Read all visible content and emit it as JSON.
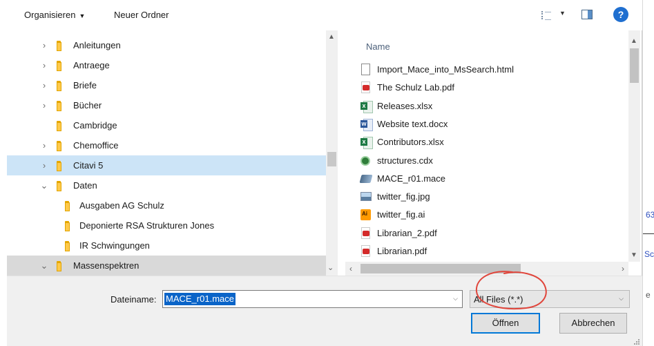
{
  "toolbar": {
    "organize_label": "Organisieren",
    "new_folder_label": "Neuer Ordner",
    "help_label": "?"
  },
  "nav": {
    "items": [
      {
        "label": "Anleitungen",
        "expander": "›"
      },
      {
        "label": "Antraege",
        "expander": "›"
      },
      {
        "label": "Briefe",
        "expander": "›"
      },
      {
        "label": "Bücher",
        "expander": "›"
      },
      {
        "label": "Cambridge",
        "expander": ""
      },
      {
        "label": "Chemoffice",
        "expander": "›"
      },
      {
        "label": "Citavi 5",
        "expander": "›"
      },
      {
        "label": "Daten",
        "expander": "⌄"
      },
      {
        "label": "Ausgaben AG Schulz",
        "expander": ""
      },
      {
        "label": "Deponierte RSA Strukturen Jones",
        "expander": ""
      },
      {
        "label": "IR Schwingungen",
        "expander": ""
      },
      {
        "label": "Massenspektren",
        "expander": "⌄"
      }
    ]
  },
  "files": {
    "column_name": "Name",
    "items": [
      {
        "name": "Import_Mace_into_MsSearch.html",
        "icon": "html-file-icon"
      },
      {
        "name": "The Schulz Lab.pdf",
        "icon": "pdf-file-icon"
      },
      {
        "name": "Releases.xlsx",
        "icon": "excel-file-icon"
      },
      {
        "name": "Website text.docx",
        "icon": "word-file-icon"
      },
      {
        "name": "Contributors.xlsx",
        "icon": "excel-file-icon"
      },
      {
        "name": "structures.cdx",
        "icon": "cdx-file-icon"
      },
      {
        "name": "MACE_r01.mace",
        "icon": "mace-file-icon"
      },
      {
        "name": "twitter_fig.jpg",
        "icon": "image-file-icon"
      },
      {
        "name": "twitter_fig.ai",
        "icon": "illustrator-file-icon"
      },
      {
        "name": "Librarian_2.pdf",
        "icon": "pdf-file-icon"
      },
      {
        "name": "Librarian.pdf",
        "icon": "pdf-file-icon"
      }
    ]
  },
  "bottom": {
    "filename_label": "Dateiname:",
    "filename_value": "MACE_r01.mace",
    "filter_value": "All Files (*.*)",
    "open_label": "Öffnen",
    "cancel_label": "Abbrechen"
  },
  "background_app": {
    "text_1": "63",
    "text_2": "Sch",
    "text_3": "e"
  },
  "colors": {
    "selection": "#cce4f7",
    "text_selection": "#0a64c8",
    "accent": "#0078d7",
    "annotation": "#e0463c"
  }
}
